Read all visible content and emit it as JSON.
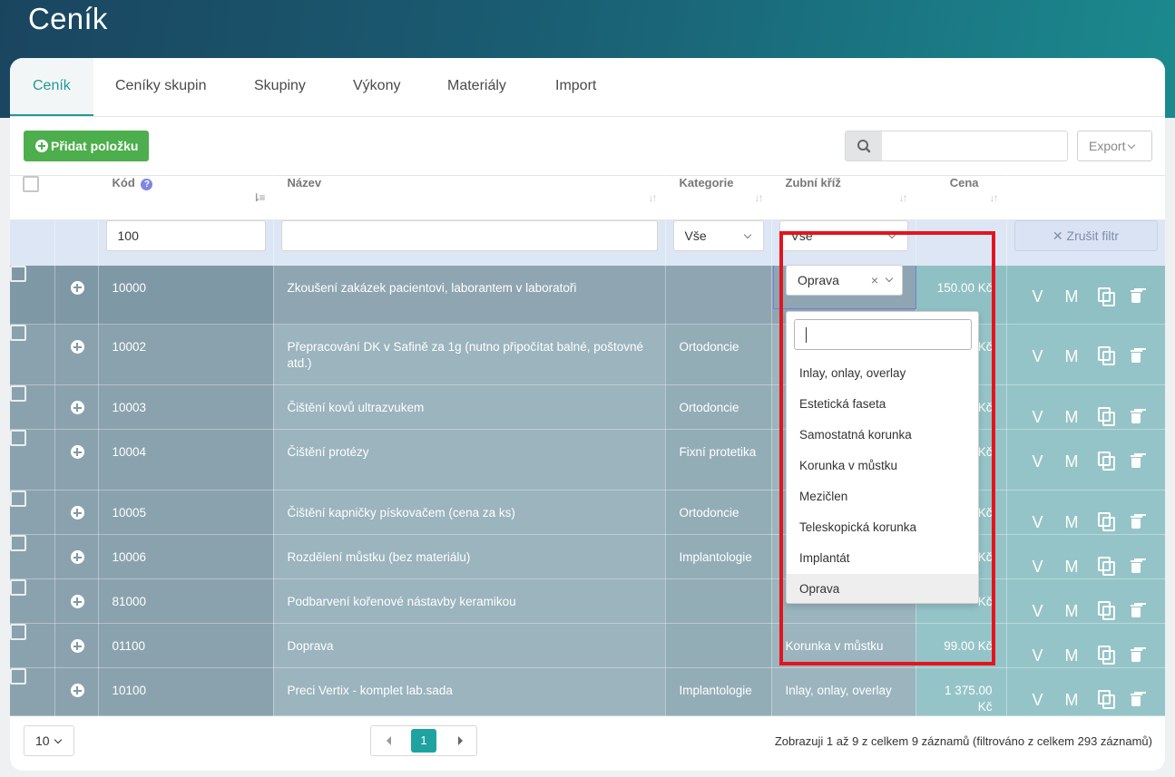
{
  "page_title": "Ceník",
  "tabs": [
    {
      "label": "Ceník",
      "active": true
    },
    {
      "label": "Ceníky skupin"
    },
    {
      "label": "Skupiny"
    },
    {
      "label": "Výkony"
    },
    {
      "label": "Materiály"
    },
    {
      "label": "Import"
    }
  ],
  "toolbar": {
    "add_label": "Přidat položku",
    "search_value": "",
    "export_label": "Export"
  },
  "columns": {
    "code": "Kód",
    "name": "Název",
    "category": "Kategorie",
    "tooth": "Zubní kříž",
    "price": "Cena"
  },
  "filters": {
    "code": "100",
    "name": "",
    "category": "Vše",
    "tooth": "Vše",
    "clear_label": "Zrušit filtr"
  },
  "rows": [
    {
      "code": "10000",
      "name": "Zkoušení zakázek pacientovi, laborantem v laboratoři",
      "category": "",
      "tooth": "Oprava",
      "price": "150.00 Kč"
    },
    {
      "code": "10002",
      "name": "Přepracování DK v Safině za 1g (nutno připočítat balné, poštovné atd.)",
      "category": "Ortodoncie",
      "tooth": "",
      "price": "Kč"
    },
    {
      "code": "10003",
      "name": "Čištění kovů ultrazvukem",
      "category": "Ortodoncie",
      "tooth": "",
      "price": "Kč"
    },
    {
      "code": "10004",
      "name": "Čištění protézy",
      "category": "Fixní protetika",
      "tooth": "",
      "price": "Kč"
    },
    {
      "code": "10005",
      "name": "Čištění kapničky pískovačem (cena za ks)",
      "category": "Ortodoncie",
      "tooth": "",
      "price": "Kč"
    },
    {
      "code": "10006",
      "name": "Rozdělení můstku (bez materiálu)",
      "category": "Implantologie",
      "tooth": "",
      "price": "Kč"
    },
    {
      "code": "81000",
      "name": "Podbarvení kořenové nástavby keramikou",
      "category": "",
      "tooth": "",
      "price": "Kč"
    },
    {
      "code": "01100",
      "name": "Doprava",
      "category": "",
      "tooth": "Korunka v můstku",
      "price": "99.00 Kč"
    },
    {
      "code": "10100",
      "name": "Preci Vertix - komplet lab.sada",
      "category": "Implantologie",
      "tooth": "Inlay, onlay, overlay",
      "price": "1 375.00 Kč"
    }
  ],
  "row_actions": {
    "v": "V",
    "m": "M"
  },
  "tooth_select": {
    "value": "Oprava",
    "clear": "×"
  },
  "dropdown_options": [
    "Inlay, onlay, overlay",
    "Estetická faseta",
    "Samostatná korunka",
    "Korunka v můstku",
    "Mezičlen",
    "Teleskopická korunka",
    "Implantát",
    "Oprava"
  ],
  "dropdown_selected": "Oprava",
  "footer": {
    "page_size": "10",
    "current_page": "1",
    "info": "Zobrazuji 1 až 9 z celkem 9 záznamů (filtrováno z celkem 293 záznamů)"
  },
  "colors": {
    "accent": "#1f9a97",
    "add_button": "#4cae4c",
    "highlight_box": "#e2151e"
  }
}
